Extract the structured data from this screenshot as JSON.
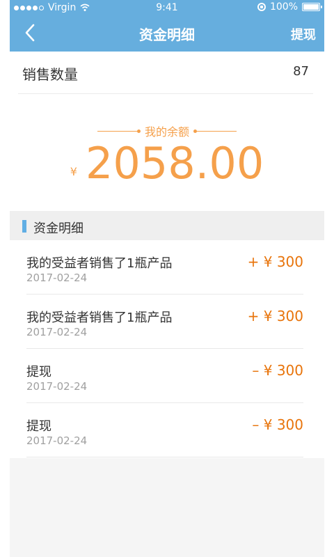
{
  "status_bar": {
    "carrier": "Virgin",
    "time": "9:41",
    "battery": "100%"
  },
  "nav": {
    "title": "资金明细",
    "action": "提现"
  },
  "sales": {
    "label": "销售数量",
    "value": "87"
  },
  "balance": {
    "label": "我的余额",
    "currency": "¥",
    "amount": "2058.00"
  },
  "section": {
    "title": "资金明细"
  },
  "transactions": [
    {
      "title": "我的受益者销售了1瓶产品",
      "date": "2017-02-24",
      "amount": "+ ¥ 300"
    },
    {
      "title": "我的受益者销售了1瓶产品",
      "date": "2017-02-24",
      "amount": "+ ¥ 300"
    },
    {
      "title": "提现",
      "date": "2017-02-24",
      "amount": "– ¥ 300"
    },
    {
      "title": "提现",
      "date": "2017-02-24",
      "amount": "– ¥ 300"
    }
  ],
  "colors": {
    "nav_bg": "#66aede",
    "accent_orange": "#f5a04b",
    "amount_orange": "#e8740b",
    "section_bar": "#60aee4"
  }
}
